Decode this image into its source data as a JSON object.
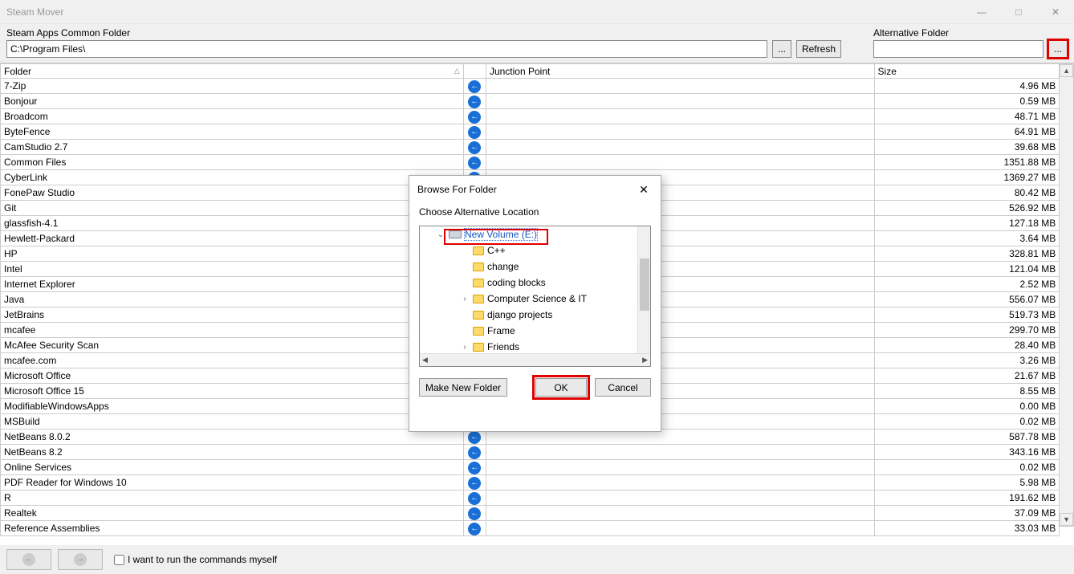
{
  "window": {
    "title": "Steam Mover"
  },
  "topbar": {
    "left_label": "Steam Apps Common Folder",
    "path_value": "C:\\Program Files\\",
    "browse_label": "...",
    "refresh_label": "Refresh",
    "right_label": "Alternative Folder",
    "alt_path_value": "",
    "alt_browse_label": "..."
  },
  "table": {
    "headers": {
      "folder": "Folder",
      "dir": "",
      "junction": "Junction Point",
      "size": "Size"
    },
    "rows": [
      {
        "folder": "7-Zip",
        "size": "4.96 MB"
      },
      {
        "folder": "Bonjour",
        "size": "0.59 MB"
      },
      {
        "folder": "Broadcom",
        "size": "48.71 MB"
      },
      {
        "folder": "ByteFence",
        "size": "64.91 MB"
      },
      {
        "folder": "CamStudio 2.7",
        "size": "39.68 MB"
      },
      {
        "folder": "Common Files",
        "size": "1351.88 MB"
      },
      {
        "folder": "CyberLink",
        "size": "1369.27 MB"
      },
      {
        "folder": "FonePaw Studio",
        "size": "80.42 MB"
      },
      {
        "folder": "Git",
        "size": "526.92 MB"
      },
      {
        "folder": "glassfish-4.1",
        "size": "127.18 MB"
      },
      {
        "folder": "Hewlett-Packard",
        "size": "3.64 MB"
      },
      {
        "folder": "HP",
        "size": "328.81 MB"
      },
      {
        "folder": "Intel",
        "size": "121.04 MB"
      },
      {
        "folder": "Internet Explorer",
        "size": "2.52 MB"
      },
      {
        "folder": "Java",
        "size": "556.07 MB"
      },
      {
        "folder": "JetBrains",
        "size": "519.73 MB"
      },
      {
        "folder": "mcafee",
        "size": "299.70 MB"
      },
      {
        "folder": "McAfee Security Scan",
        "size": "28.40 MB"
      },
      {
        "folder": "mcafee.com",
        "size": "3.26 MB"
      },
      {
        "folder": "Microsoft Office",
        "size": "21.67 MB"
      },
      {
        "folder": "Microsoft Office 15",
        "size": "8.55 MB"
      },
      {
        "folder": "ModifiableWindowsApps",
        "size": "0.00 MB"
      },
      {
        "folder": "MSBuild",
        "size": "0.02 MB"
      },
      {
        "folder": "NetBeans 8.0.2",
        "size": "587.78 MB"
      },
      {
        "folder": "NetBeans 8.2",
        "size": "343.16 MB"
      },
      {
        "folder": "Online Services",
        "size": "0.02 MB"
      },
      {
        "folder": "PDF Reader for Windows 10",
        "size": "5.98 MB"
      },
      {
        "folder": "R",
        "size": "191.62 MB"
      },
      {
        "folder": "Realtek",
        "size": "37.09 MB"
      },
      {
        "folder": "Reference Assemblies",
        "size": "33.03 MB"
      }
    ]
  },
  "footer": {
    "checkbox_label": "I want to run the commands myself"
  },
  "dialog": {
    "title": "Browse For Folder",
    "subtitle": "Choose Alternative Location",
    "tree": [
      {
        "depth": 0,
        "label": "New Volume (E:)",
        "type": "drive",
        "expandable": true,
        "expanded": true,
        "selected": true
      },
      {
        "depth": 1,
        "label": "C++",
        "type": "folder"
      },
      {
        "depth": 1,
        "label": "change",
        "type": "folder"
      },
      {
        "depth": 1,
        "label": "coding blocks",
        "type": "folder"
      },
      {
        "depth": 1,
        "label": "Computer Science & IT",
        "type": "folder",
        "expandable": true
      },
      {
        "depth": 1,
        "label": "django projects",
        "type": "folder"
      },
      {
        "depth": 1,
        "label": "Frame",
        "type": "folder"
      },
      {
        "depth": 1,
        "label": "Friends",
        "type": "folder",
        "expandable": true
      }
    ],
    "buttons": {
      "make_new": "Make New Folder",
      "ok": "OK",
      "cancel": "Cancel"
    }
  }
}
